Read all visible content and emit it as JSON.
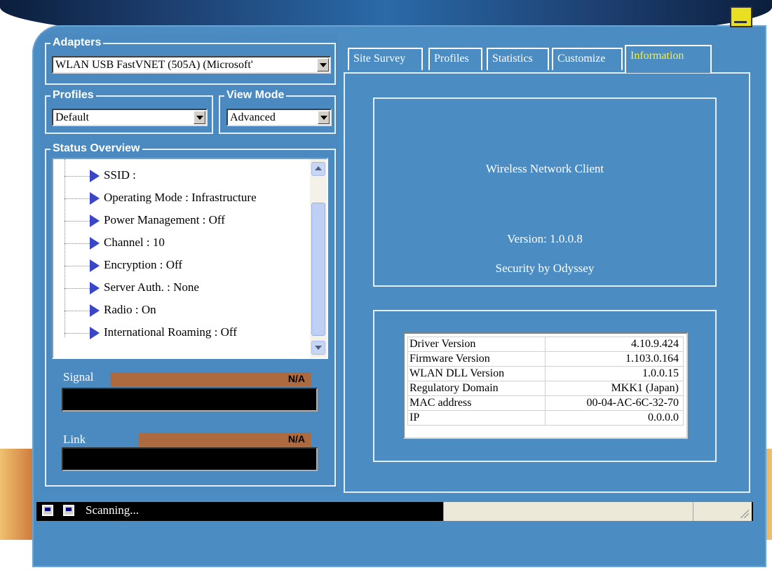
{
  "adapters": {
    "title": "Adapters",
    "selected": "WLAN USB FastVNET (505A) (Microsoft'"
  },
  "profiles": {
    "title": "Profiles",
    "selected": "Default"
  },
  "view_mode": {
    "title": "View Mode",
    "selected": "Advanced"
  },
  "status_overview": {
    "title": "Status Overview",
    "items": [
      "SSID :",
      "Operating Mode : Infrastructure",
      "Power Management : Off",
      "Channel : 10",
      "Encryption : Off",
      "Server Auth. : None",
      "Radio : On",
      "International Roaming : Off"
    ]
  },
  "signal": {
    "label": "Signal",
    "value": "N/A"
  },
  "link": {
    "label": "Link",
    "value": "N/A"
  },
  "statusbar": {
    "text": "Scanning..."
  },
  "tabs": [
    "Site Survey",
    "Profiles",
    "Statistics",
    "Customize",
    "Information"
  ],
  "active_tab": "Information",
  "info": {
    "product": "Wireless Network Client",
    "version": "Version: 1.0.0.8",
    "security": "Security by Odyssey",
    "rows": [
      {
        "label": "Driver Version",
        "value": "4.10.9.424"
      },
      {
        "label": "Firmware Version",
        "value": "1.103.0.164"
      },
      {
        "label": "WLAN DLL Version",
        "value": "1.0.0.15"
      },
      {
        "label": "Regulatory Domain",
        "value": "MKK1 (Japan)"
      },
      {
        "label": "MAC address",
        "value": "00-04-AC-6C-32-70"
      },
      {
        "label": "IP",
        "value": "0.0.0.0"
      }
    ]
  },
  "colors": {
    "panel": "#4b8cc3",
    "active_tab_text": "#f8f040",
    "meter_fill": "#ad6a3e"
  }
}
